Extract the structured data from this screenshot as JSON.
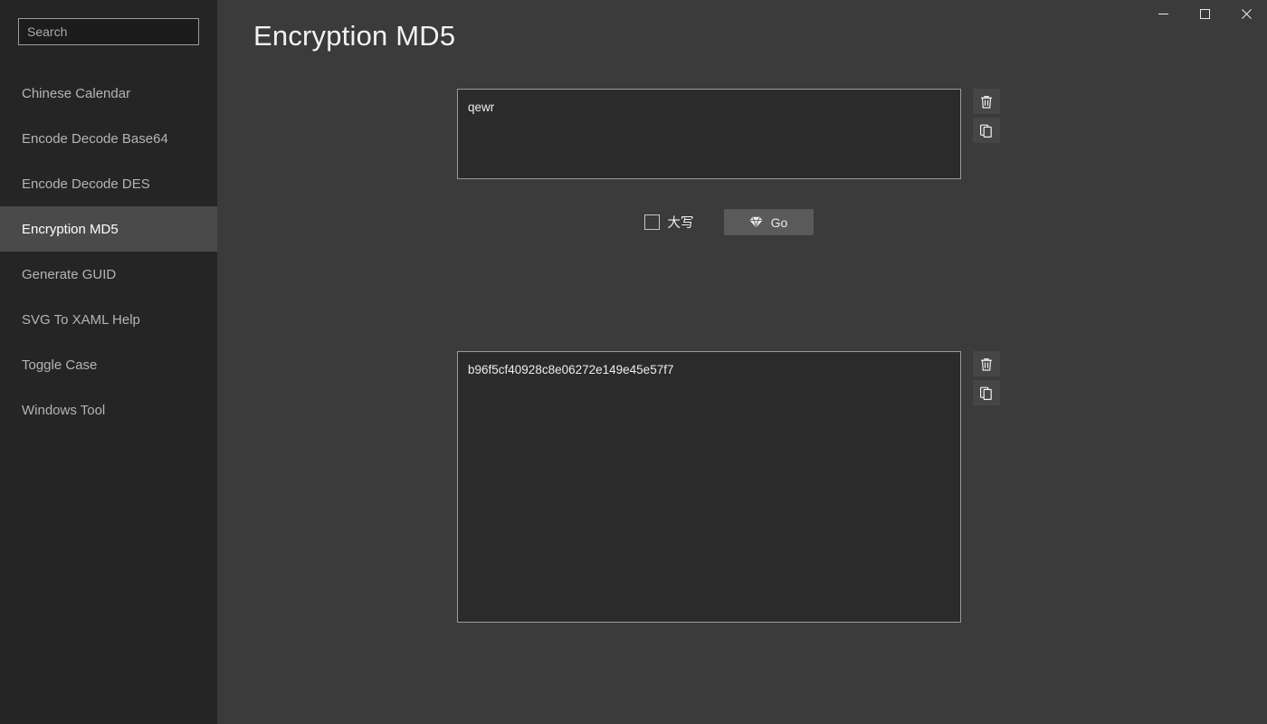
{
  "window": {
    "controls": [
      {
        "name": "minimize",
        "glyph": "minimize-icon",
        "label": "Minimize"
      },
      {
        "name": "maximize",
        "glyph": "maximize-icon",
        "label": "Maximize"
      },
      {
        "name": "close",
        "glyph": "close-icon",
        "label": "Close"
      }
    ]
  },
  "sidebar": {
    "search": {
      "placeholder": "Search",
      "value": ""
    },
    "items": [
      {
        "label": "Chinese Calendar",
        "selected": false
      },
      {
        "label": "Encode Decode Base64",
        "selected": false
      },
      {
        "label": "Encode Decode DES",
        "selected": false
      },
      {
        "label": "Encryption MD5",
        "selected": true
      },
      {
        "label": "Generate GUID",
        "selected": false
      },
      {
        "label": "SVG To XAML Help",
        "selected": false
      },
      {
        "label": "Toggle Case",
        "selected": false
      },
      {
        "label": "Windows Tool",
        "selected": false
      }
    ]
  },
  "main": {
    "title": "Encryption MD5",
    "input": {
      "value": "qewr",
      "placeholder": "",
      "clear_tooltip": "Clear",
      "copy_tooltip": "Copy"
    },
    "controls": {
      "uppercase_label": "大写",
      "uppercase_checked": false,
      "go_label": "Go",
      "go_icon": "diamond-icon"
    },
    "output": {
      "value": "b96f5cf40928c8e06272e149e45e57f7",
      "placeholder": "",
      "clear_tooltip": "Clear",
      "copy_tooltip": "Copy"
    }
  },
  "colors": {
    "sidebar_bg": "#252525",
    "content_bg": "#3b3b3b",
    "selected_item_bg": "#4a4a4a",
    "textbox_bg": "#2b2b2b",
    "textbox_border": "#9a9a9a",
    "button_bg": "#5a5a5a",
    "tool_button_bg": "#464646",
    "text_primary": "#f2f2f2",
    "text_secondary": "#b4b4b4"
  }
}
